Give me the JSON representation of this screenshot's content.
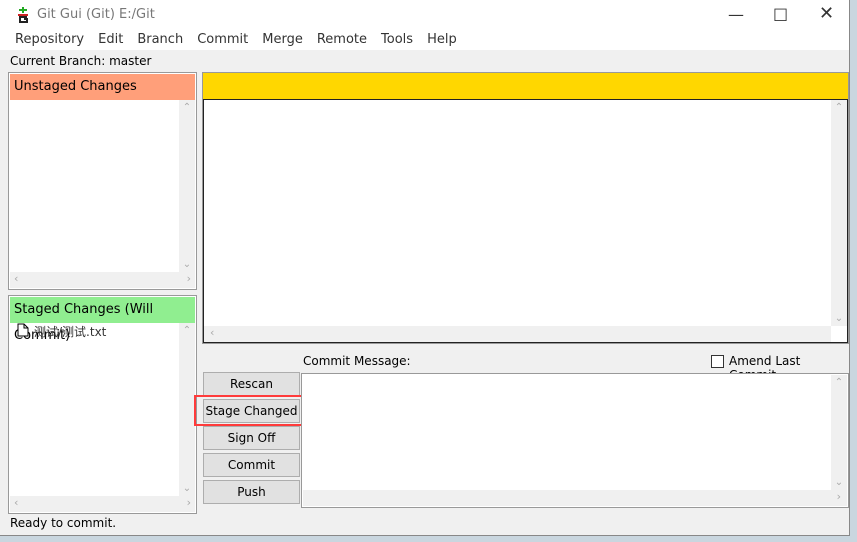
{
  "window": {
    "title": "Git Gui (Git) E:/Git",
    "icon": "git-gui-icon",
    "controls": [
      "minimize",
      "maximize",
      "close"
    ]
  },
  "menu": [
    "Repository",
    "Edit",
    "Branch",
    "Commit",
    "Merge",
    "Remote",
    "Tools",
    "Help"
  ],
  "branch_label": "Current Branch: master",
  "unstaged": {
    "header": "Unstaged Changes",
    "color": "#ff9f7a",
    "files": []
  },
  "staged": {
    "header": "Staged Changes (Will Commit)",
    "color": "#90ee90",
    "files": [
      {
        "name": "测试/测试.txt",
        "icon": "file-icon"
      }
    ]
  },
  "diff": {
    "header_color": "#ffd700"
  },
  "commit": {
    "label": "Commit Message:",
    "amend_label": "Amend Last Commit",
    "amend_checked": false,
    "message": ""
  },
  "buttons": [
    "Rescan",
    "Stage Changed",
    "Sign Off",
    "Commit",
    "Push"
  ],
  "highlight": {
    "target": "Stage Changed",
    "color": "#ff3b3b"
  },
  "status": "Ready to commit."
}
